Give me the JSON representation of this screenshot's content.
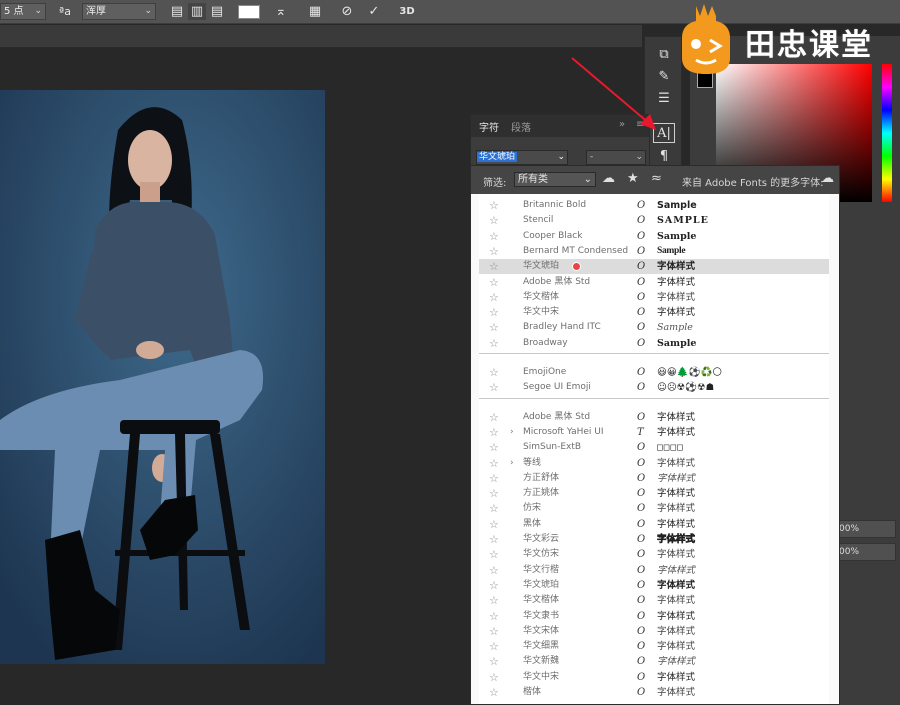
{
  "options_bar": {
    "font_size": "5 点",
    "aa_label": "a",
    "antialias": "浑厚",
    "icons": [
      "align-left-icon",
      "align-center-icon",
      "align-right-icon",
      "warp-text-icon",
      "character-panel-icon",
      "cancel-icon",
      "commit-icon"
    ],
    "three_d": "3D"
  },
  "character_panel": {
    "tabs": [
      "字符",
      "段落"
    ],
    "font_name_value": "华文琥珀",
    "font_style_value": "-"
  },
  "font_menu": {
    "filter_label": "筛选:",
    "filter_value": "所有类",
    "adobe_fonts_label": "来自 Adobe Fonts 的更多字体:",
    "groups": [
      [
        {
          "name": "Britannic Bold",
          "sample": "Sample",
          "style": "sans-bold"
        },
        {
          "name": "Stencil",
          "sample": "SAMPLE",
          "style": "stencil"
        },
        {
          "name": "Cooper Black",
          "sample": "Sample",
          "style": "heavy"
        },
        {
          "name": "Bernard MT Condensed",
          "sample": "Sample",
          "style": "condensed"
        },
        {
          "name": "华文琥珀",
          "sample": "字体样式",
          "style": "heavy",
          "highlighted": true
        },
        {
          "name": "Adobe 黑体 Std",
          "sample": "字体样式",
          "style": "normal"
        },
        {
          "name": "华文楷体",
          "sample": "字体样式",
          "style": "light"
        },
        {
          "name": "华文中宋",
          "sample": "字体样式",
          "style": "normal"
        },
        {
          "name": "Bradley Hand ITC",
          "sample": "Sample",
          "style": "script"
        },
        {
          "name": "Broadway",
          "sample": "Sample",
          "style": "heavy"
        }
      ],
      [
        {
          "name": "EmojiOne",
          "sample": "😃😀🌲⚽♻️🌕",
          "style": "emoji",
          "type_icon": "O"
        },
        {
          "name": "Segoe UI Emoji",
          "sample": "☺☹☢⚽☢☗",
          "style": "emoji"
        }
      ],
      [
        {
          "name": "Adobe 黑体 Std",
          "sample": "字体样式",
          "style": "normal"
        },
        {
          "name": "Microsoft YaHei UI",
          "sample": "字体样式",
          "style": "normal",
          "arrow": true,
          "type_icon": "T"
        },
        {
          "name": "SimSun-ExtB",
          "sample": "□□□□",
          "style": "boxes"
        },
        {
          "name": "等线",
          "sample": "字体样式",
          "style": "light",
          "arrow": true
        },
        {
          "name": "方正舒体",
          "sample": "字体样式",
          "style": "script"
        },
        {
          "name": "方正姚体",
          "sample": "字体样式",
          "style": "normal"
        },
        {
          "name": "仿宋",
          "sample": "字体样式",
          "style": "light"
        },
        {
          "name": "黑体",
          "sample": "字体样式",
          "style": "normal"
        },
        {
          "name": "华文彩云",
          "sample": "字体样式",
          "style": "outline"
        },
        {
          "name": "华文仿宋",
          "sample": "字体样式",
          "style": "light"
        },
        {
          "name": "华文行楷",
          "sample": "字体样式",
          "style": "script"
        },
        {
          "name": "华文琥珀",
          "sample": "字体样式",
          "style": "heavy"
        },
        {
          "name": "华文楷体",
          "sample": "字体样式",
          "style": "light"
        },
        {
          "name": "华文隶书",
          "sample": "字体样式",
          "style": "normal"
        },
        {
          "name": "华文宋体",
          "sample": "字体样式",
          "style": "light"
        },
        {
          "name": "华文细黑",
          "sample": "字体样式",
          "style": "light"
        },
        {
          "name": "华文新魏",
          "sample": "字体样式",
          "style": "script"
        },
        {
          "name": "华文中宋",
          "sample": "字体样式",
          "style": "normal"
        },
        {
          "name": "楷体",
          "sample": "字体样式",
          "style": "light"
        }
      ]
    ]
  },
  "right_dock": {
    "rows": [
      "00%",
      "00%"
    ]
  },
  "watermark": {
    "text": "田忠课堂"
  },
  "colors": {
    "app_bg": "#282828",
    "panel": "#3c3c3c",
    "selection_blue": "#2d72d2",
    "annotation_red": "#e8192c",
    "watermark_orange": "#f39a1e"
  }
}
